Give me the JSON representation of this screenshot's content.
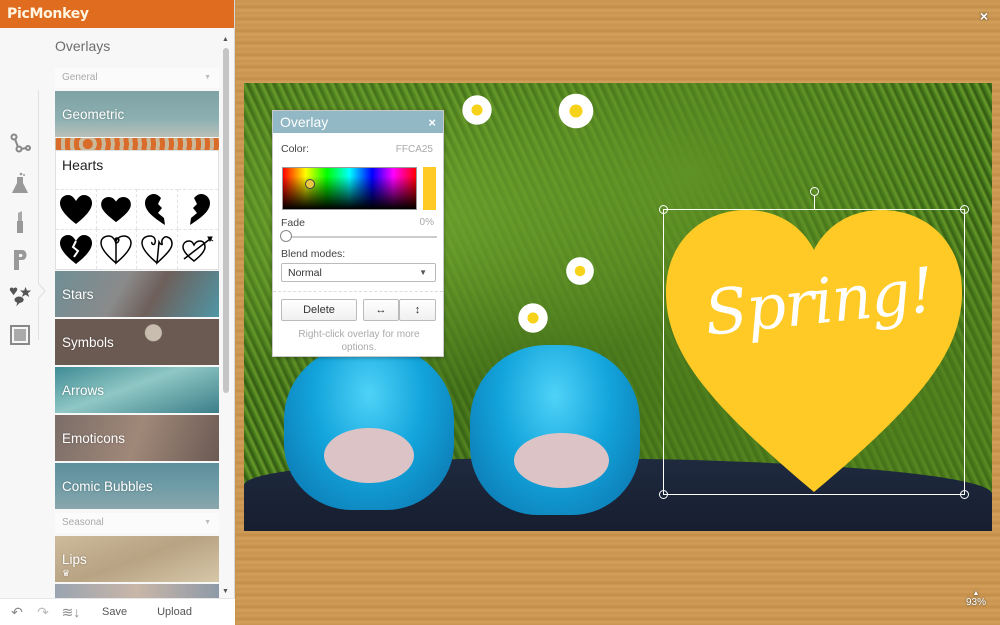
{
  "app": {
    "name": "PicMonkey"
  },
  "sidebar": {
    "panel_title": "Overlays",
    "tool_rail": [
      {
        "icon": "basic-edits-icon"
      },
      {
        "icon": "effects-icon"
      },
      {
        "icon": "touch-up-icon"
      },
      {
        "icon": "text-icon"
      },
      {
        "icon": "overlays-icon",
        "active": true
      },
      {
        "icon": "frames-icon"
      }
    ],
    "sections": [
      {
        "label": "General",
        "categories": [
          {
            "label": "Geometric"
          },
          {
            "label": "Hearts",
            "expanded": true
          },
          {
            "label": "Stars"
          },
          {
            "label": "Symbols"
          },
          {
            "label": "Arrows"
          },
          {
            "label": "Emoticons"
          },
          {
            "label": "Comic Bubbles"
          }
        ]
      },
      {
        "label": "Seasonal",
        "categories": [
          {
            "label": "Lips",
            "premium_icon": "crown-icon"
          }
        ]
      }
    ],
    "hearts_items": [
      "solid-heart",
      "solid-heart-wide",
      "half-heart-left",
      "half-heart-right",
      "broken-heart",
      "outline-heart-swirl",
      "outline-heart-curl",
      "heart-with-arrow"
    ]
  },
  "bottom_bar": {
    "undo": "undo-icon",
    "redo": "redo-icon",
    "layers": "layers-icon",
    "save_label": "Save",
    "upload_label": "Upload"
  },
  "workspace": {
    "close": "×",
    "zoom_level": "93%"
  },
  "overlay_dialog": {
    "title": "Overlay",
    "close": "×",
    "color_label": "Color:",
    "color_value": "FFCA25",
    "color_hex": "#FFCA25",
    "fade_label": "Fade",
    "fade_value": "0%",
    "fade_fraction": 0,
    "blend_label": "Blend modes:",
    "blend_selected": "Normal",
    "delete_label": "Delete",
    "flip_h": "↔",
    "flip_v": "↕",
    "hint": "Right-click overlay for more options."
  },
  "canvas_overlay": {
    "text": "Spring!",
    "fill": "#FFCA25"
  }
}
